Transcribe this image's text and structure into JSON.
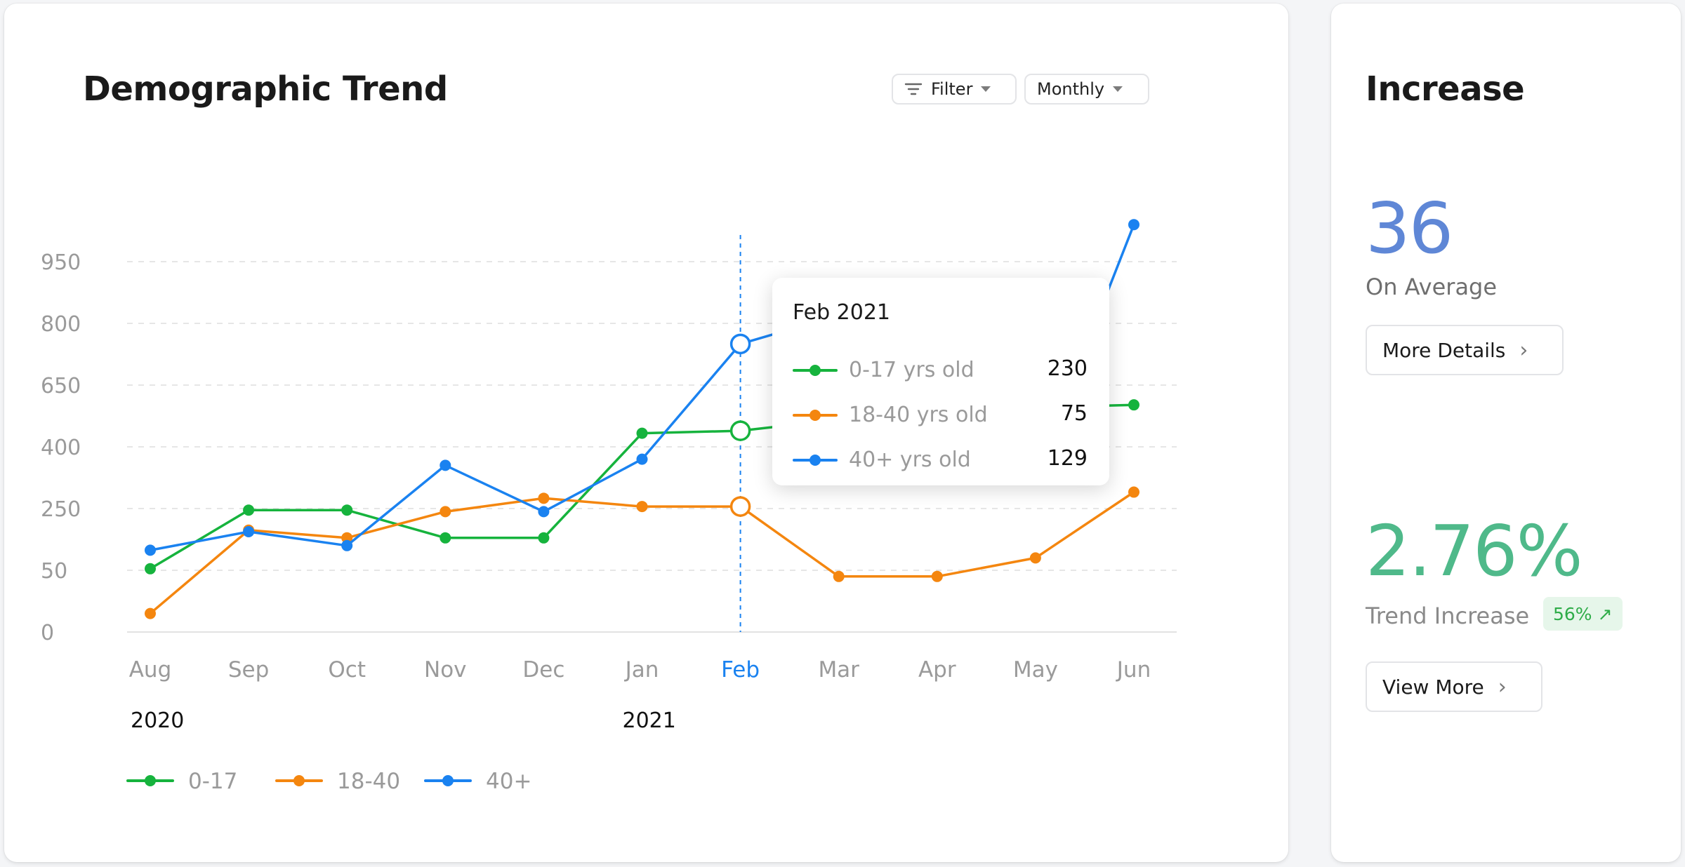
{
  "main": {
    "title": "Demographic Trend",
    "filter_label": "Filter",
    "period_label": "Monthly"
  },
  "chart_data": {
    "type": "line",
    "categories": [
      "Aug",
      "Sep",
      "Oct",
      "Nov",
      "Dec",
      "Jan",
      "Feb",
      "Mar",
      "Apr",
      "May",
      "Jun"
    ],
    "y_ticks": [
      0,
      50,
      250,
      400,
      650,
      800,
      950
    ],
    "year_labels": [
      {
        "label": "2020",
        "at": "Aug"
      },
      {
        "label": "2021",
        "at": "Jan"
      }
    ],
    "highlighted_category": "Feb",
    "series": [
      {
        "name": "0-17",
        "color": "#16b33d",
        "values": [
          55,
          245,
          245,
          155,
          155,
          455,
          465,
          510,
          530,
          560,
          570
        ]
      },
      {
        "name": "18-40",
        "color": "#f4860f",
        "values": [
          15,
          180,
          155,
          240,
          275,
          255,
          255,
          45,
          45,
          90,
          290
        ]
      },
      {
        "name": "40+",
        "color": "#1a82f0",
        "values": [
          115,
          175,
          130,
          355,
          240,
          370,
          750,
          820,
          330,
          330,
          1040
        ]
      }
    ],
    "legend_placement": "bottom-left",
    "grid": true
  },
  "tooltip": {
    "title": "Feb 2021",
    "rows": [
      {
        "label": "0-17 yrs old",
        "value": "230"
      },
      {
        "label": "18-40 yrs old",
        "value": "75"
      },
      {
        "label": "40+ yrs old",
        "value": "129"
      }
    ]
  },
  "side": {
    "title": "Increase",
    "average_value": "36",
    "average_caption": "On Average",
    "more_details_label": "More Details",
    "trend_value": "2.76%",
    "trend_caption": "Trend Increase",
    "badge_text": "56%",
    "badge_icon": "arrow-up-right-icon",
    "view_more_label": "View More"
  },
  "colors": {
    "accent_blue": "#1a82f0",
    "average_value": "#5f87d6",
    "trend_value": "#4fb98a",
    "badge_green": "#2eac48"
  }
}
